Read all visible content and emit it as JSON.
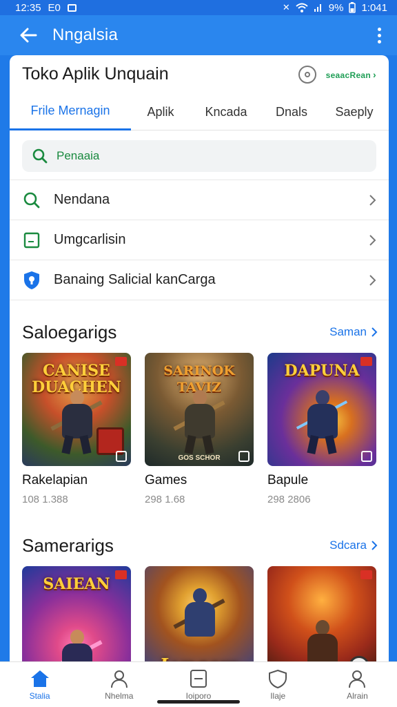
{
  "status_bar": {
    "time": "12:35",
    "left_label": "E0",
    "battery": "9%",
    "clock_right": "1:041"
  },
  "app_bar": {
    "title": "Nngalsia"
  },
  "store": {
    "title": "Toko Aplik Unquain",
    "header_link": "seaacRean"
  },
  "tabs": [
    {
      "label": "Frile Mernagin",
      "active": true
    },
    {
      "label": "Aplik",
      "active": false
    },
    {
      "label": "Kncada",
      "active": false
    },
    {
      "label": "Dnals",
      "active": false
    },
    {
      "label": "Saeply",
      "active": false
    }
  ],
  "search": {
    "placeholder": "Penaaia"
  },
  "menu": [
    {
      "label": "Nendana",
      "icon": "search-icon"
    },
    {
      "label": "Umgcarlisin",
      "icon": "square-icon"
    },
    {
      "label": "Banaing Salicial kanCarga",
      "icon": "shield-icon"
    }
  ],
  "section1": {
    "title": "Saloegarigs",
    "link": "Saman",
    "cards": [
      {
        "art_title": "CANISE DUACHEN",
        "title": "Rakelapian",
        "sub": "108 1.388",
        "colors": [
          "#c7502a",
          "#3d5a2a",
          "#2a3a5c"
        ]
      },
      {
        "art_title": "SARINOK TAVIZ",
        "title": "Games",
        "sub": "298 1.68",
        "art_caption": "GOS SCHOR",
        "colors": [
          "#7a5a33",
          "#3a3f30",
          "#1f2a2a"
        ]
      },
      {
        "art_title": "DAPUNA",
        "title": "Bapule",
        "sub": "298 2806",
        "colors": [
          "#1d3a8a",
          "#6a2f9a",
          "#d8701f"
        ]
      }
    ]
  },
  "section2": {
    "title": "Samerarigs",
    "link": "Sdcara",
    "cards": [
      {
        "art_title": "SAIEAN",
        "colors": [
          "#1f3a9a",
          "#8a2f9a",
          "#e04a8a"
        ]
      },
      {
        "art_title": "Lyngars",
        "colors": [
          "#a2531f",
          "#2f3f8a",
          "#e0a030"
        ]
      },
      {
        "art_title": "",
        "colors": [
          "#9a2a1a",
          "#d0501a",
          "#3a1a10"
        ]
      }
    ]
  },
  "bottom_nav": [
    {
      "label": "Stalia",
      "icon": "home-icon",
      "active": true
    },
    {
      "label": "Nhelma",
      "icon": "person-icon",
      "active": false
    },
    {
      "label": "Ioiporo",
      "icon": "tablet-icon",
      "active": false
    },
    {
      "label": "Ilaje",
      "icon": "shield-icon",
      "active": false
    },
    {
      "label": "Alrain",
      "icon": "account-icon",
      "active": false
    }
  ],
  "colors": {
    "primary": "#1a73e8",
    "app_bar": "#2a86ee",
    "accent_green": "#1e9e55"
  }
}
